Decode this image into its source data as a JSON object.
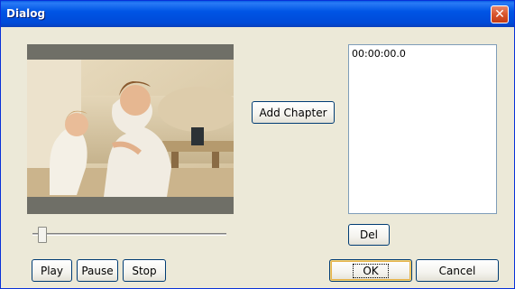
{
  "window": {
    "title": "Dialog"
  },
  "chapters": {
    "add_label": "Add Chapter",
    "items": [
      "00:00:00.0"
    ],
    "del_label": "Del"
  },
  "playback": {
    "play_label": "Play",
    "pause_label": "Pause",
    "stop_label": "Stop",
    "position": 0.03
  },
  "dialog": {
    "ok_label": "OK",
    "cancel_label": "Cancel"
  },
  "colors": {
    "title_bar": "#0055e5",
    "face": "#ece9d8",
    "button_border": "#003c74"
  }
}
